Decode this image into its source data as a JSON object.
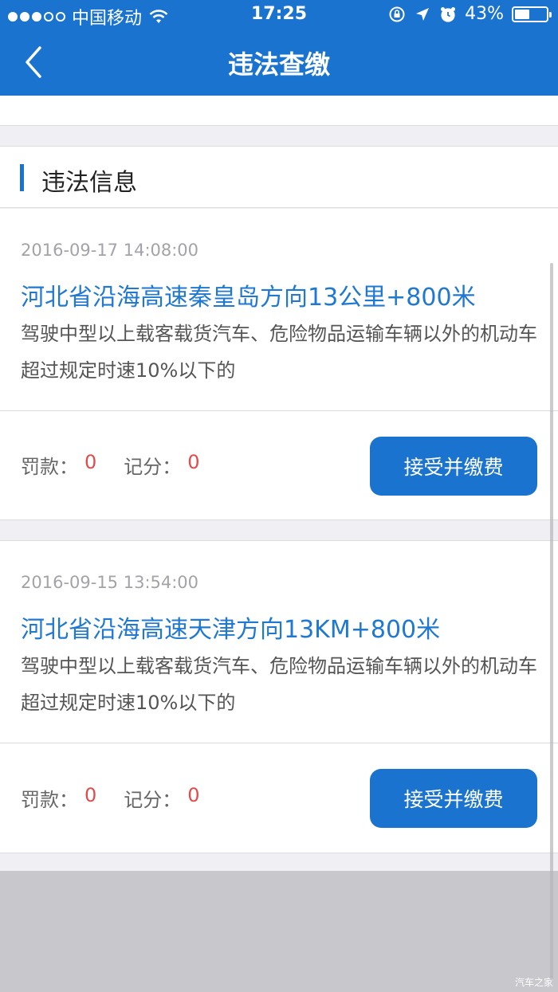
{
  "status_bar": {
    "carrier": "中国移动",
    "time": "17:25",
    "battery": "43%",
    "battery_level": 0.43,
    "signal_bars_filled": 3,
    "signal_bars_total": 5
  },
  "nav": {
    "title": "违法查缴",
    "back_icon": "chevron-left-icon"
  },
  "section": {
    "title": "违法信息"
  },
  "violations": [
    {
      "time": "2016-09-17 14:08:00",
      "location": "河北省沿海高速秦皇岛方向13公里+800米",
      "description": "驾驶中型以上载客载货汽车、危险物品运输车辆以外的机动车超过规定时速10%以下的",
      "fine_label": "罚款：",
      "fine_value": "0",
      "points_label": "记分：",
      "points_value": "0",
      "button_label": "接受并缴费"
    },
    {
      "time": "2016-09-15 13:54:00",
      "location": "河北省沿海高速天津方向13KM+800米",
      "description": "驾驶中型以上载客载货汽车、危险物品运输车辆以外的机动车超过规定时速10%以下的",
      "fine_label": "罚款：",
      "fine_value": "0",
      "points_label": "记分：",
      "points_value": "0",
      "button_label": "接受并缴费"
    }
  ],
  "watermark": "汽车之家",
  "colors": {
    "primary": "#1a73cf",
    "link": "#1f78d1",
    "value_red": "#e24b4b"
  }
}
